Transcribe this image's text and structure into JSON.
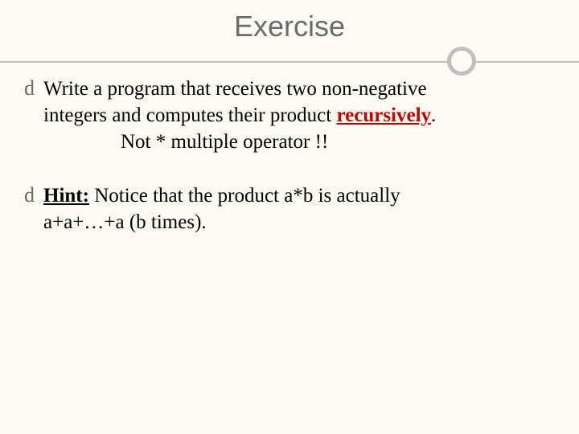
{
  "title": "Exercise",
  "bullets": [
    {
      "prefix": "",
      "line1_a": "Write a program that receives two non-negative",
      "line2_a": "integers and computes their product ",
      "line2_b_red": "recursively",
      "line2_c": ".",
      "indent": "Not  * multiple operator !!"
    },
    {
      "hint_label": "Hint:",
      "hint_rest": " Notice that the product a*b is actually",
      "hint_line2": "a+a+…+a (b times)."
    }
  ],
  "glyph": "d"
}
